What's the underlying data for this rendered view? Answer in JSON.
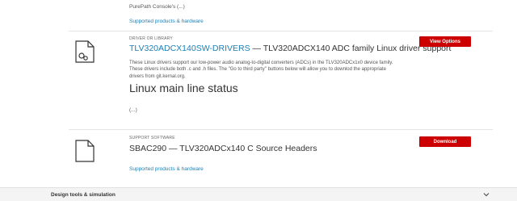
{
  "top": {
    "snippet": "PurePath Console's (...)",
    "support_link": "Supported products & hardware"
  },
  "items": [
    {
      "type": "DRIVER OR LIBRARY",
      "id": "TLV320ADCX140SW-DRIVERS",
      "sep": " — ",
      "title": "TLV320ADCX140 ADC family Linux driver support",
      "description": "These Linux drivers support our low-power audio analog-to-digital converters (ADCs) in the TLV320ADCx1x0 device family. These drivers include both .c and .h files. The \"Go to third party\" buttons below will allow you to downlod the appropriate drivers from git.kernal.org.",
      "heading": "Linux main line status",
      "ellipsis": "(...)",
      "button": "View Options",
      "icon": "file-gear-icon"
    },
    {
      "type": "SUPPORT SOFTWARE",
      "id": "SBAC290",
      "sep": " — ",
      "title": "TLV320ADCx140 C Source Headers",
      "support_link": "Supported products & hardware",
      "button": "Download",
      "icon": "file-icon"
    }
  ],
  "footer": {
    "title": "Design tools & simulation",
    "icon": "chevron-down-icon"
  },
  "colors": {
    "link": "#1b7fb5",
    "button": "#cc0000"
  }
}
